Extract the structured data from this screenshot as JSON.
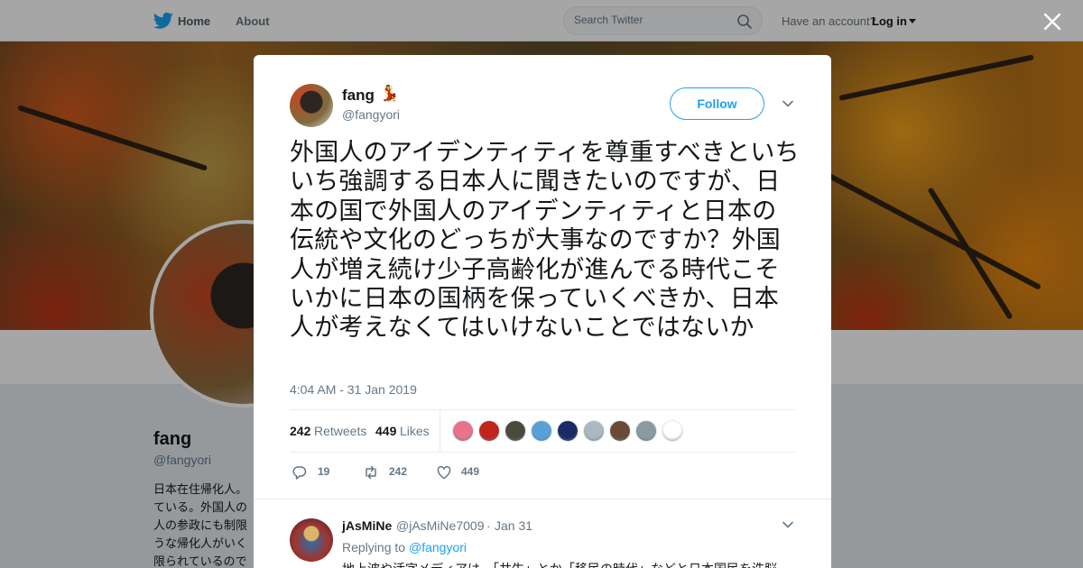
{
  "nav": {
    "home": "Home",
    "about": "About",
    "search_placeholder": "Search Twitter",
    "have_account": "Have an account?",
    "login": "Log in"
  },
  "background_profile": {
    "name": "fang",
    "handle": "@fangyori",
    "bio": "日本在住帰化人。ている。外国人の人の参政にも制限うな帰化人がいく限られているので"
  },
  "tweet": {
    "author_name": "fang",
    "author_emoji": "💃",
    "author_handle": "@fangyori",
    "follow_label": "Follow",
    "text": "外国人のアイデンティティを尊重すべきといちいち強調する日本人に聞きたいのですが、日本の国で外国人のアイデンティティと日本の伝統や文化のどっちが大事なのですか？外国人が増え続け少子高齢化が進んでる時代こそいかに日本の国柄を保っていくべきか、日本人が考えなくてはいけないことではないか",
    "timestamp": "4:04 AM - 31 Jan 2019",
    "retweets_count": "242",
    "retweets_label": "Retweets",
    "likes_count": "449",
    "likes_label": "Likes",
    "reply_action_count": "19",
    "retweet_action_count": "242",
    "like_action_count": "449",
    "liker_colors": [
      "#e9748a",
      "#c2231b",
      "#4b4a3a",
      "#5aa0d8",
      "#1b2a66",
      "#aab8c2",
      "#6a4a36",
      "#8a9aa0",
      "#ffffff"
    ]
  },
  "reply": {
    "name": "jAsMiNe",
    "handle": "@jAsMiNe7009",
    "separator": "·",
    "date": "Jan 31",
    "replying_label": "Replying to",
    "replying_to": "@fangyori",
    "text": "地上波や活字メディアは、「共生」とか「移民の時代」などと日本国民を洗脳"
  },
  "colors": {
    "accent": "#1da1f2",
    "text": "#14171a",
    "muted": "#657786"
  }
}
